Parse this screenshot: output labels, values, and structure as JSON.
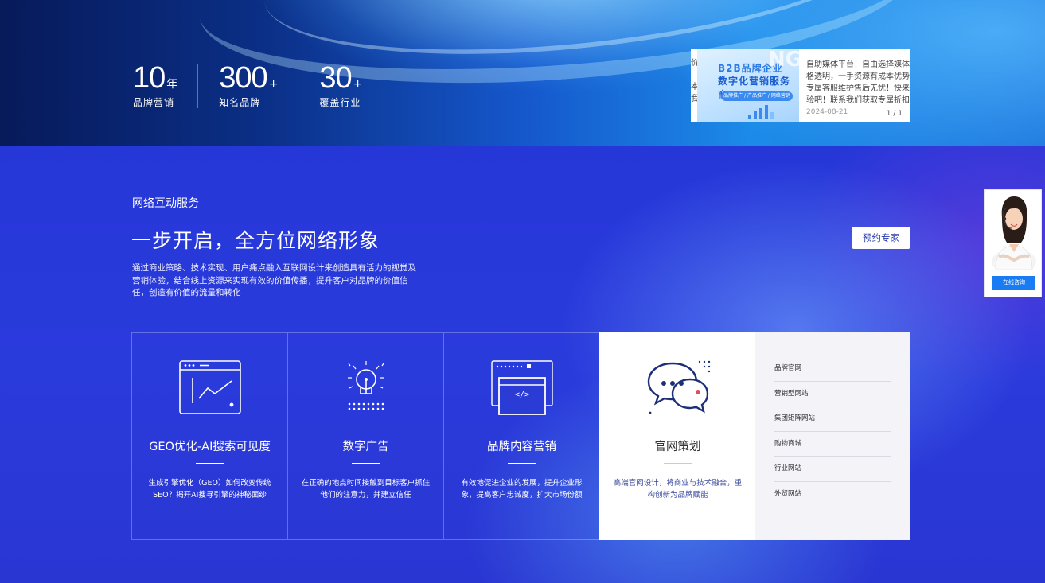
{
  "hero": {
    "stats": [
      {
        "number": "10",
        "unit": "年",
        "label": "品牌营销"
      },
      {
        "number": "300",
        "unit": "+",
        "label": "知名品牌"
      },
      {
        "number": "30",
        "unit": "+",
        "label": "覆盖行业"
      }
    ]
  },
  "news": {
    "strip_text": [
      "价",
      "本",
      "我"
    ],
    "image_bg_text": "NG",
    "image_line1": "B2B品牌企业",
    "image_line2": "数字化营销服务商",
    "image_pill": "品牌推广 / 产品推广 / 网络营销",
    "text_lines": [
      "自助媒体平台！自由选择媒体价",
      "格透明，一手资源有成本优势，",
      "专属客服维护售后无忧！快来体",
      "验吧！联系我们获取专属折扣"
    ],
    "date": "2024-08-21",
    "page": "1 / 1"
  },
  "section": {
    "tag": "网络互动服务",
    "title": "一步开启，全方位网络形象",
    "description": "通过商业策略、技术实现、用户痛点融入互联网设计来创造具有活力的视觉及营销体验，结合线上资源来实现有效的价值传播，提升客户对品牌的价值信任，创造有价值的流量和转化",
    "cta_label": "预约专家"
  },
  "cards": [
    {
      "icon": "chart-trend-icon",
      "title": "GEO优化-AI搜索可见度",
      "desc": "生成引擎优化（GEO）如何改变传统SEO？揭开AI搜寻引擎的神秘面纱"
    },
    {
      "icon": "lightbulb-icon",
      "title": "数字广告",
      "desc": "在正确的地点时间接触到目标客户抓住他们的注意力，并建立信任"
    },
    {
      "icon": "code-window-icon",
      "title": "品牌内容营销",
      "desc": "有效地促进企业的发展，提升企业形象，提高客户忠诚度，扩大市场份额"
    },
    {
      "icon": "chat-bubbles-icon",
      "title": "官网策划",
      "desc": "高端官网设计，将商业与技术融合，重构创新为品牌赋能"
    }
  ],
  "submenu": [
    "品牌官网",
    "营销型网站",
    "集团矩阵网站",
    "购物商城",
    "行业网站",
    "外贸网站"
  ],
  "consult": {
    "button_label": "在线咨询"
  },
  "colors": {
    "accent_blue": "#2a3bd6",
    "button_blue": "#1a7cf2",
    "icon_navy": "#1d2f78",
    "dot_red": "#e0505a"
  }
}
